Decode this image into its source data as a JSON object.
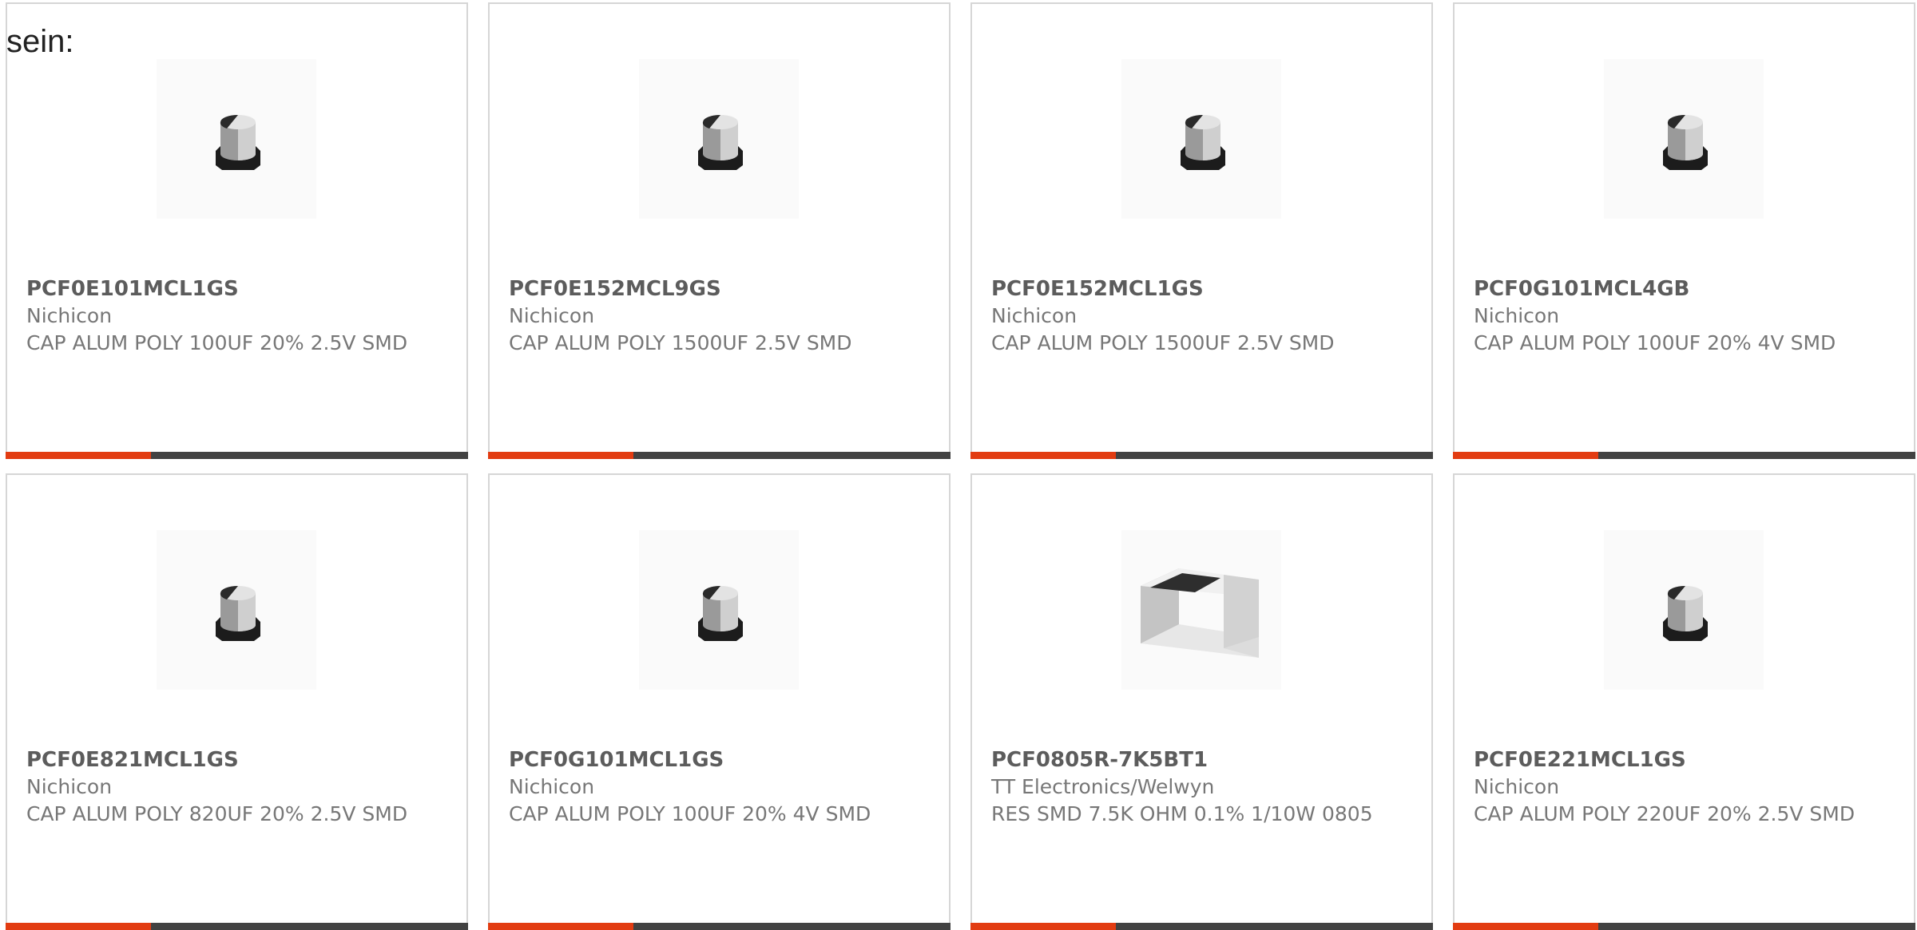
{
  "intro_text": "sein:",
  "colors": {
    "accent": "#e23c12",
    "bar_dark": "#424242",
    "card_border": "#d6d6d6",
    "text_gray": "#777777"
  },
  "products": [
    {
      "part_number": "PCF0E101MCL1GS",
      "manufacturer": "Nichicon",
      "description": "CAP ALUM POLY 100UF 20% 2.5V SMD",
      "image": "capacitor-image"
    },
    {
      "part_number": "PCF0E152MCL9GS",
      "manufacturer": "Nichicon",
      "description": "CAP ALUM POLY 1500UF 2.5V SMD",
      "image": "capacitor-image"
    },
    {
      "part_number": "PCF0E152MCL1GS",
      "manufacturer": "Nichicon",
      "description": "CAP ALUM POLY 1500UF 2.5V SMD",
      "image": "capacitor-image"
    },
    {
      "part_number": "PCF0G101MCL4GB",
      "manufacturer": "Nichicon",
      "description": "CAP ALUM POLY 100UF 20% 4V SMD",
      "image": "capacitor-image"
    },
    {
      "part_number": "PCF0E821MCL1GS",
      "manufacturer": "Nichicon",
      "description": "CAP ALUM POLY 820UF 20% 2.5V SMD",
      "image": "capacitor-image"
    },
    {
      "part_number": "PCF0G101MCL1GS",
      "manufacturer": "Nichicon",
      "description": "CAP ALUM POLY 100UF 20% 4V SMD",
      "image": "capacitor-image"
    },
    {
      "part_number": "PCF0805R-7K5BT1",
      "manufacturer": "TT Electronics/Welwyn",
      "description": "RES SMD 7.5K OHM 0.1% 1/10W 0805",
      "image": "resistor-image"
    },
    {
      "part_number": "PCF0E221MCL1GS",
      "manufacturer": "Nichicon",
      "description": "CAP ALUM POLY 220UF 20% 2.5V SMD",
      "image": "capacitor-image"
    }
  ]
}
